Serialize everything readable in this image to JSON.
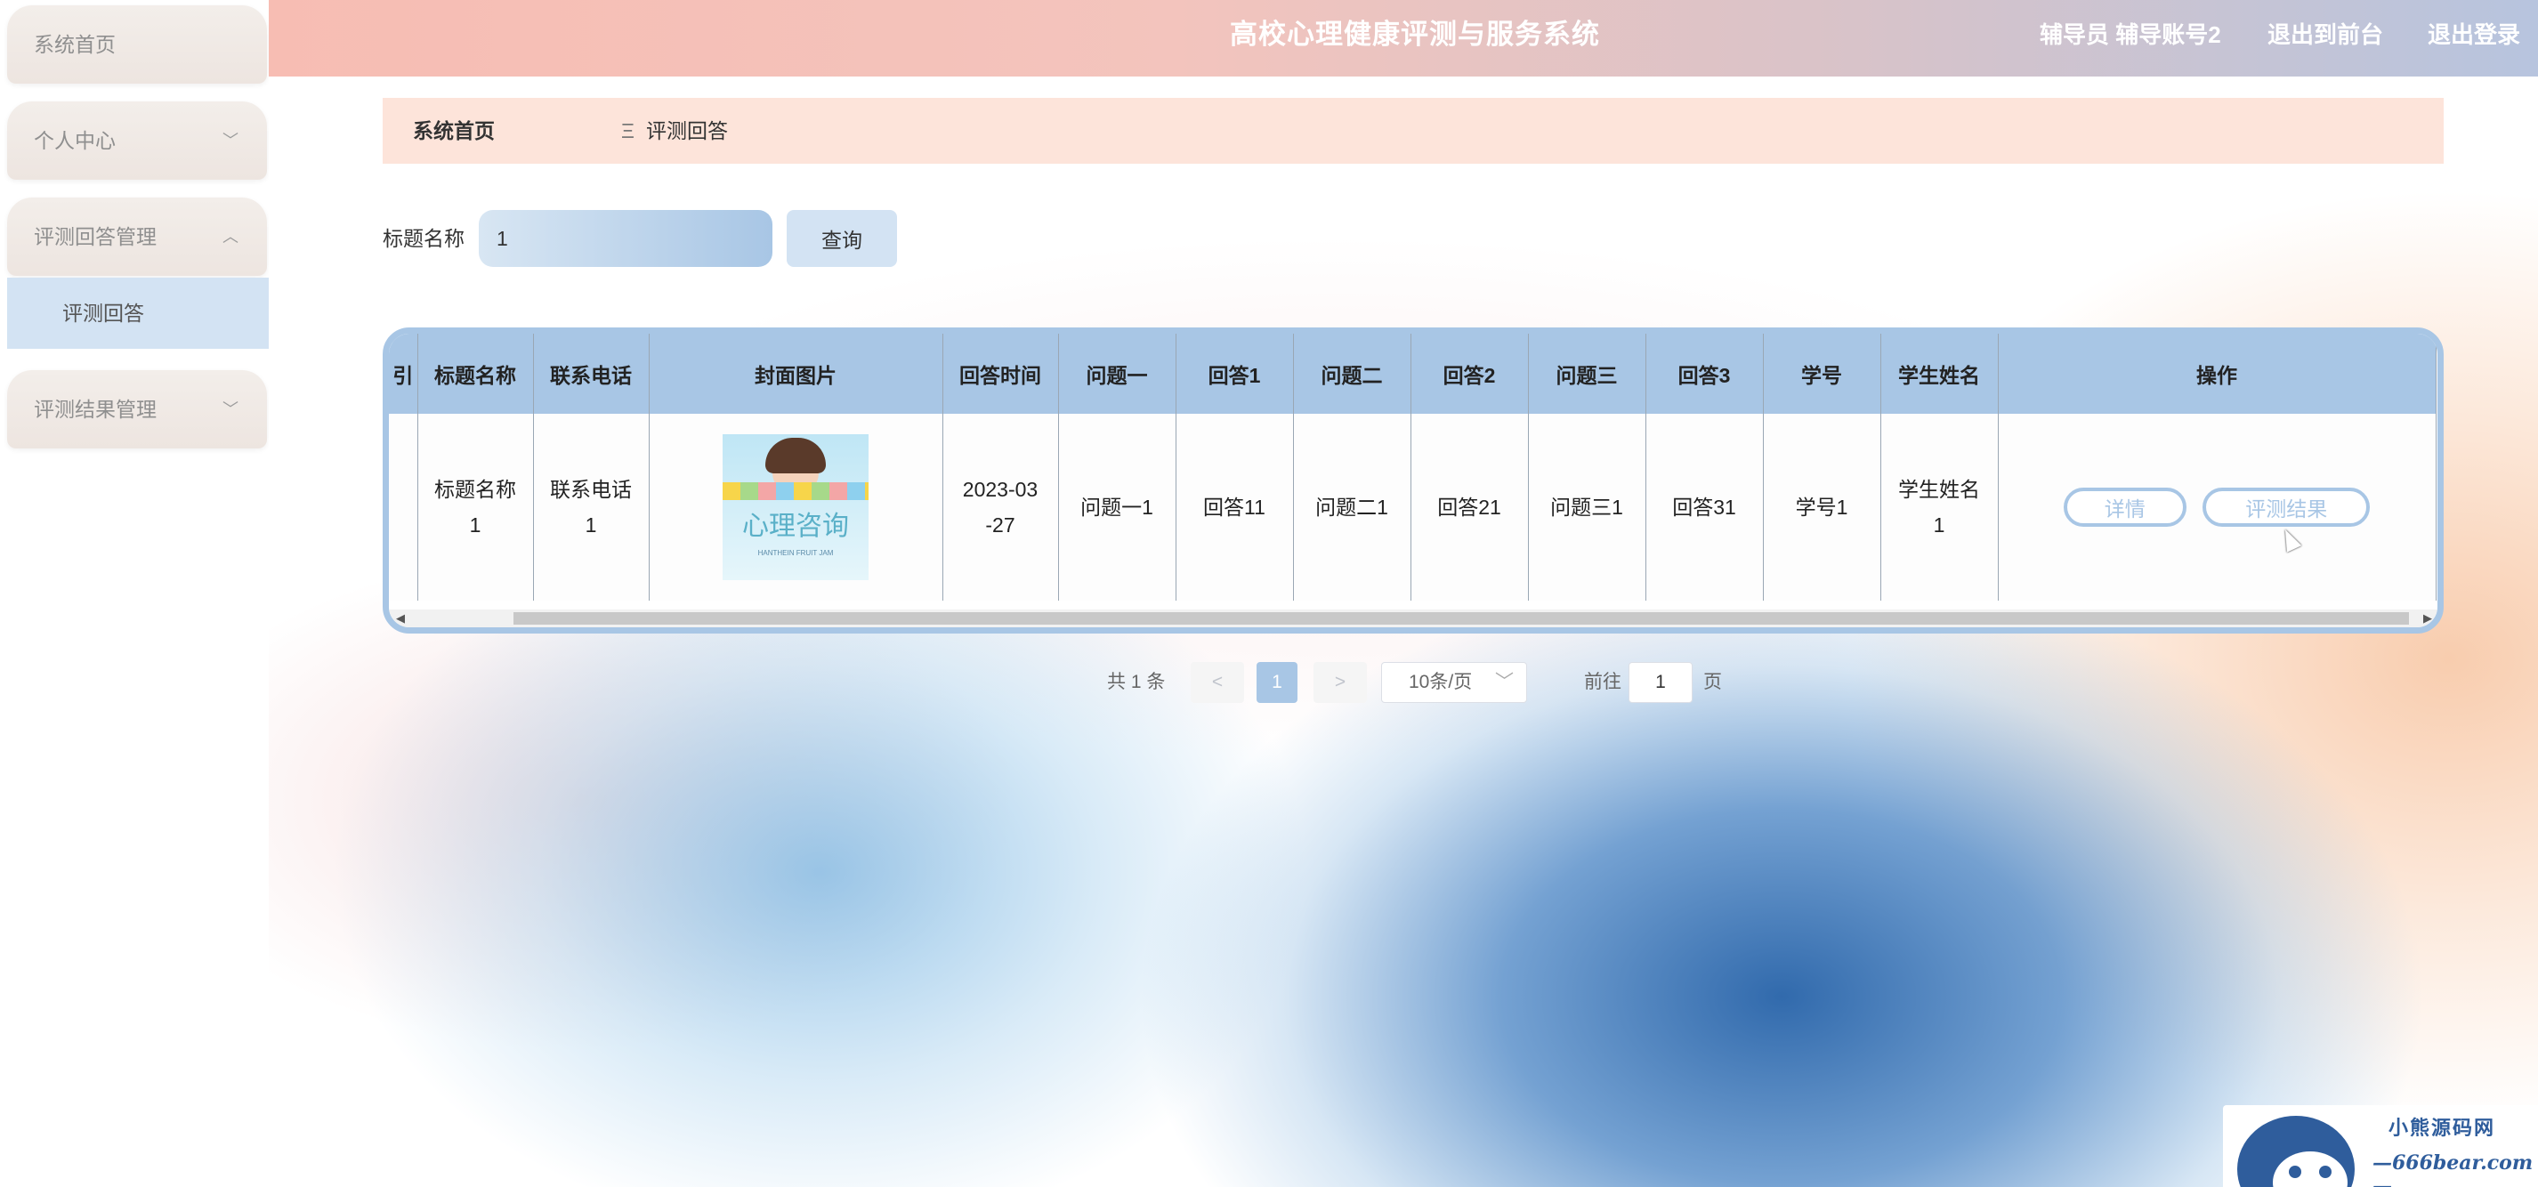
{
  "header": {
    "system_title": "高校心理健康评测与服务系统",
    "user_label": "辅导员 辅导账号2",
    "to_front": "退出到前台",
    "logout": "退出登录"
  },
  "sidebar": {
    "items": [
      {
        "label": "系统首页",
        "chevron": ""
      },
      {
        "label": "个人中心",
        "chevron": "﹀"
      },
      {
        "label": "评测回答管理",
        "chevron": "︿"
      },
      {
        "label": "评测结果管理",
        "chevron": "﹀"
      }
    ],
    "sub_items": [
      {
        "label": "评测回答"
      }
    ]
  },
  "breadcrumb": {
    "home": "系统首页",
    "separator": "Ξ",
    "current": "评测回答"
  },
  "search": {
    "label": "标题名称",
    "value": "1",
    "button": "查询"
  },
  "table": {
    "headers": [
      "引",
      "标题名称",
      "联系电话",
      "封面图片",
      "回答时间",
      "问题一",
      "回答1",
      "问题二",
      "回答2",
      "问题三",
      "回答3",
      "学号",
      "学生姓名",
      "操作"
    ],
    "rows": [
      {
        "index": "",
        "title": "标题名称\n1",
        "phone": "联系电话\n1",
        "cover_text": "心理咨询",
        "cover_sub": "HANTHEIN FRUIT JAM",
        "time": "2023-03\n-27",
        "q1": "问题一1",
        "a1": "回答11",
        "q2": "问题二1",
        "a2": "回答21",
        "q3": "问题三1",
        "a3": "回答31",
        "student_no": "学号1",
        "student_name": "学生姓名\n1",
        "btn_detail": "详情",
        "btn_result": "评测结果"
      }
    ]
  },
  "pagination": {
    "total": "共 1 条",
    "prev": "<",
    "current_page": "1",
    "next": ">",
    "page_size": "10条/页",
    "goto_label": "前往",
    "goto_value": "1",
    "page_suffix": "页"
  },
  "watermark": {
    "line1": "小熊源码网",
    "line2": "—666bear.com—"
  },
  "colors": {
    "accent": "#a8c6e5",
    "breadcrumb_bg": "#fde4da",
    "topbar_start": "#f7bdb3",
    "topbar_end": "#b7c4de"
  }
}
